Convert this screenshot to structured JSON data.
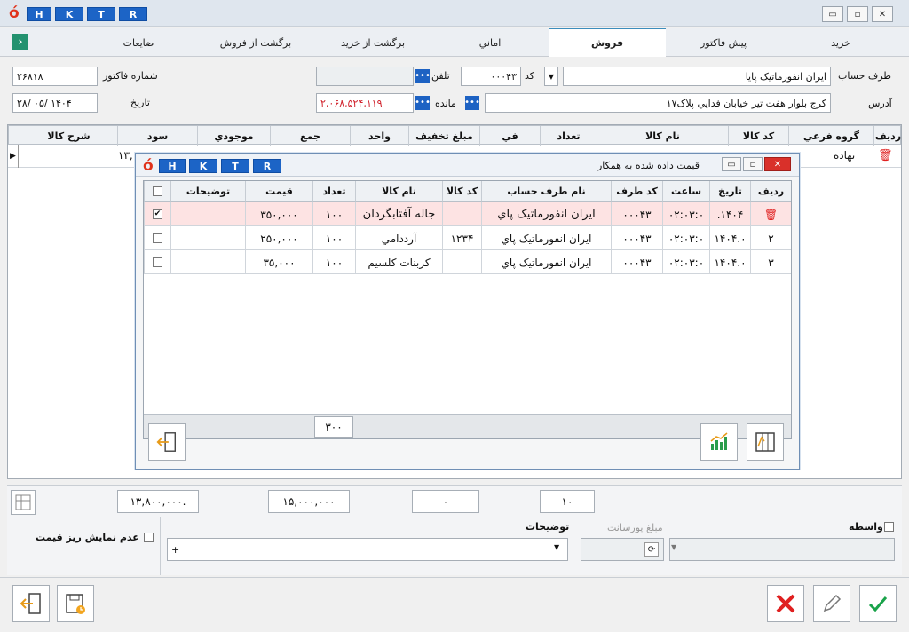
{
  "app": {
    "logo": "ó",
    "hotkeys": [
      "H",
      "K",
      "T",
      "R"
    ],
    "window_buttons": [
      "▭",
      "▫",
      "✕"
    ]
  },
  "tabs": [
    {
      "label": "خريد"
    },
    {
      "label": "پيش فاکتور"
    },
    {
      "label": "فروش"
    },
    {
      "label": "اماني"
    },
    {
      "label": "برگشت از خريد"
    },
    {
      "label": "برگشت از فروش"
    },
    {
      "label": "ضايعات"
    }
  ],
  "form": {
    "account_label": "طرف حساب",
    "account_value": "ايران انفورماتيک پايا",
    "code_label": "کد",
    "code_value": "۰۰۰۴۳",
    "phone_label": "تلفن",
    "phone_value": "",
    "invoice_no_label": "شماره فاکتور",
    "invoice_no_value": "۲۶۸۱۸",
    "address_label": "آدرس",
    "address_value": "کرج بلوار هفت تير خيابان فدايي پلاک۱۷",
    "balance_label": "مانده",
    "balance_value": "۲,۰۶۸,۵۲۴,۱۱۹",
    "date_label": "تاريخ",
    "date_value": "۱۴۰۴ /۰۵ /۲۸"
  },
  "main_grid": {
    "headers": [
      "رديف",
      "گروه فرعي",
      "کد کالا",
      "نام کالا",
      "تعداد",
      "في",
      "مبلغ تخفيف",
      "واحد",
      "جمع",
      "موجودي",
      "سود",
      "شرح کالا"
    ],
    "row": {
      "group": "نهاده",
      "profit": "۱۳,"
    }
  },
  "dialog": {
    "title": "قيمت داده شده به همکار",
    "headers": [
      "رديف",
      "تاريخ",
      "ساعت",
      "کد طرف",
      "نام طرف حساب",
      "کد کالا",
      "نام کالا",
      "تعداد",
      "قيمت",
      "توضيحات"
    ],
    "rows": [
      {
        "row": "",
        "date": "۱۴۰۴.",
        "time": "۰۲:۰۳:۰",
        "party_code": "۰۰۰۴۳",
        "party_name": "ايران انفورماتيک پاي",
        "item_code": "",
        "item_name": "جاله آفتابگردان",
        "qty": "۱۰۰",
        "price": "۳۵۰,۰۰۰",
        "desc": "",
        "checked": "✔"
      },
      {
        "row": "۲",
        "date": "۱۴۰۴.۰",
        "time": "۰۲:۰۳:۰",
        "party_code": "۰۰۰۴۳",
        "party_name": "ايران انفورماتيک پاي",
        "item_code": "۱۲۳۴",
        "item_name": "آرددامي",
        "qty": "۱۰۰",
        "price": "۲۵۰,۰۰۰",
        "desc": "",
        "checked": ""
      },
      {
        "row": "۳",
        "date": "۱۴۰۴.۰",
        "time": "۰۲:۰۳:۰",
        "party_code": "۰۰۰۴۳",
        "party_name": "ايران انفورماتيک پاي",
        "item_code": "",
        "item_name": "کربنات کلسيم",
        "qty": "۱۰۰",
        "price": "۳۵,۰۰۰",
        "desc": "",
        "checked": ""
      }
    ],
    "qty_total": "۳۰۰"
  },
  "totals": {
    "profit_total": "۱۳,۸۰۰,۰۰۰.",
    "sum_total": "۱۵,۰۰۰,۰۰۰",
    "discount_total": "۰",
    "qty_total": "۱۰"
  },
  "footer": {
    "broker_label": "واسطه",
    "commission_label": "مبلغ پورسانت",
    "description_label": "توضيحات",
    "description_value": "+",
    "hide_price_detail_label": "عدم نمايش ريز قيمت"
  },
  "colors": {
    "accent": "#1d62c3",
    "logo": "#e0321b",
    "selected_row": "#fde3e3",
    "balance_text": "#d0202a",
    "confirm": "#1aa34a",
    "cancel": "#e02020"
  }
}
